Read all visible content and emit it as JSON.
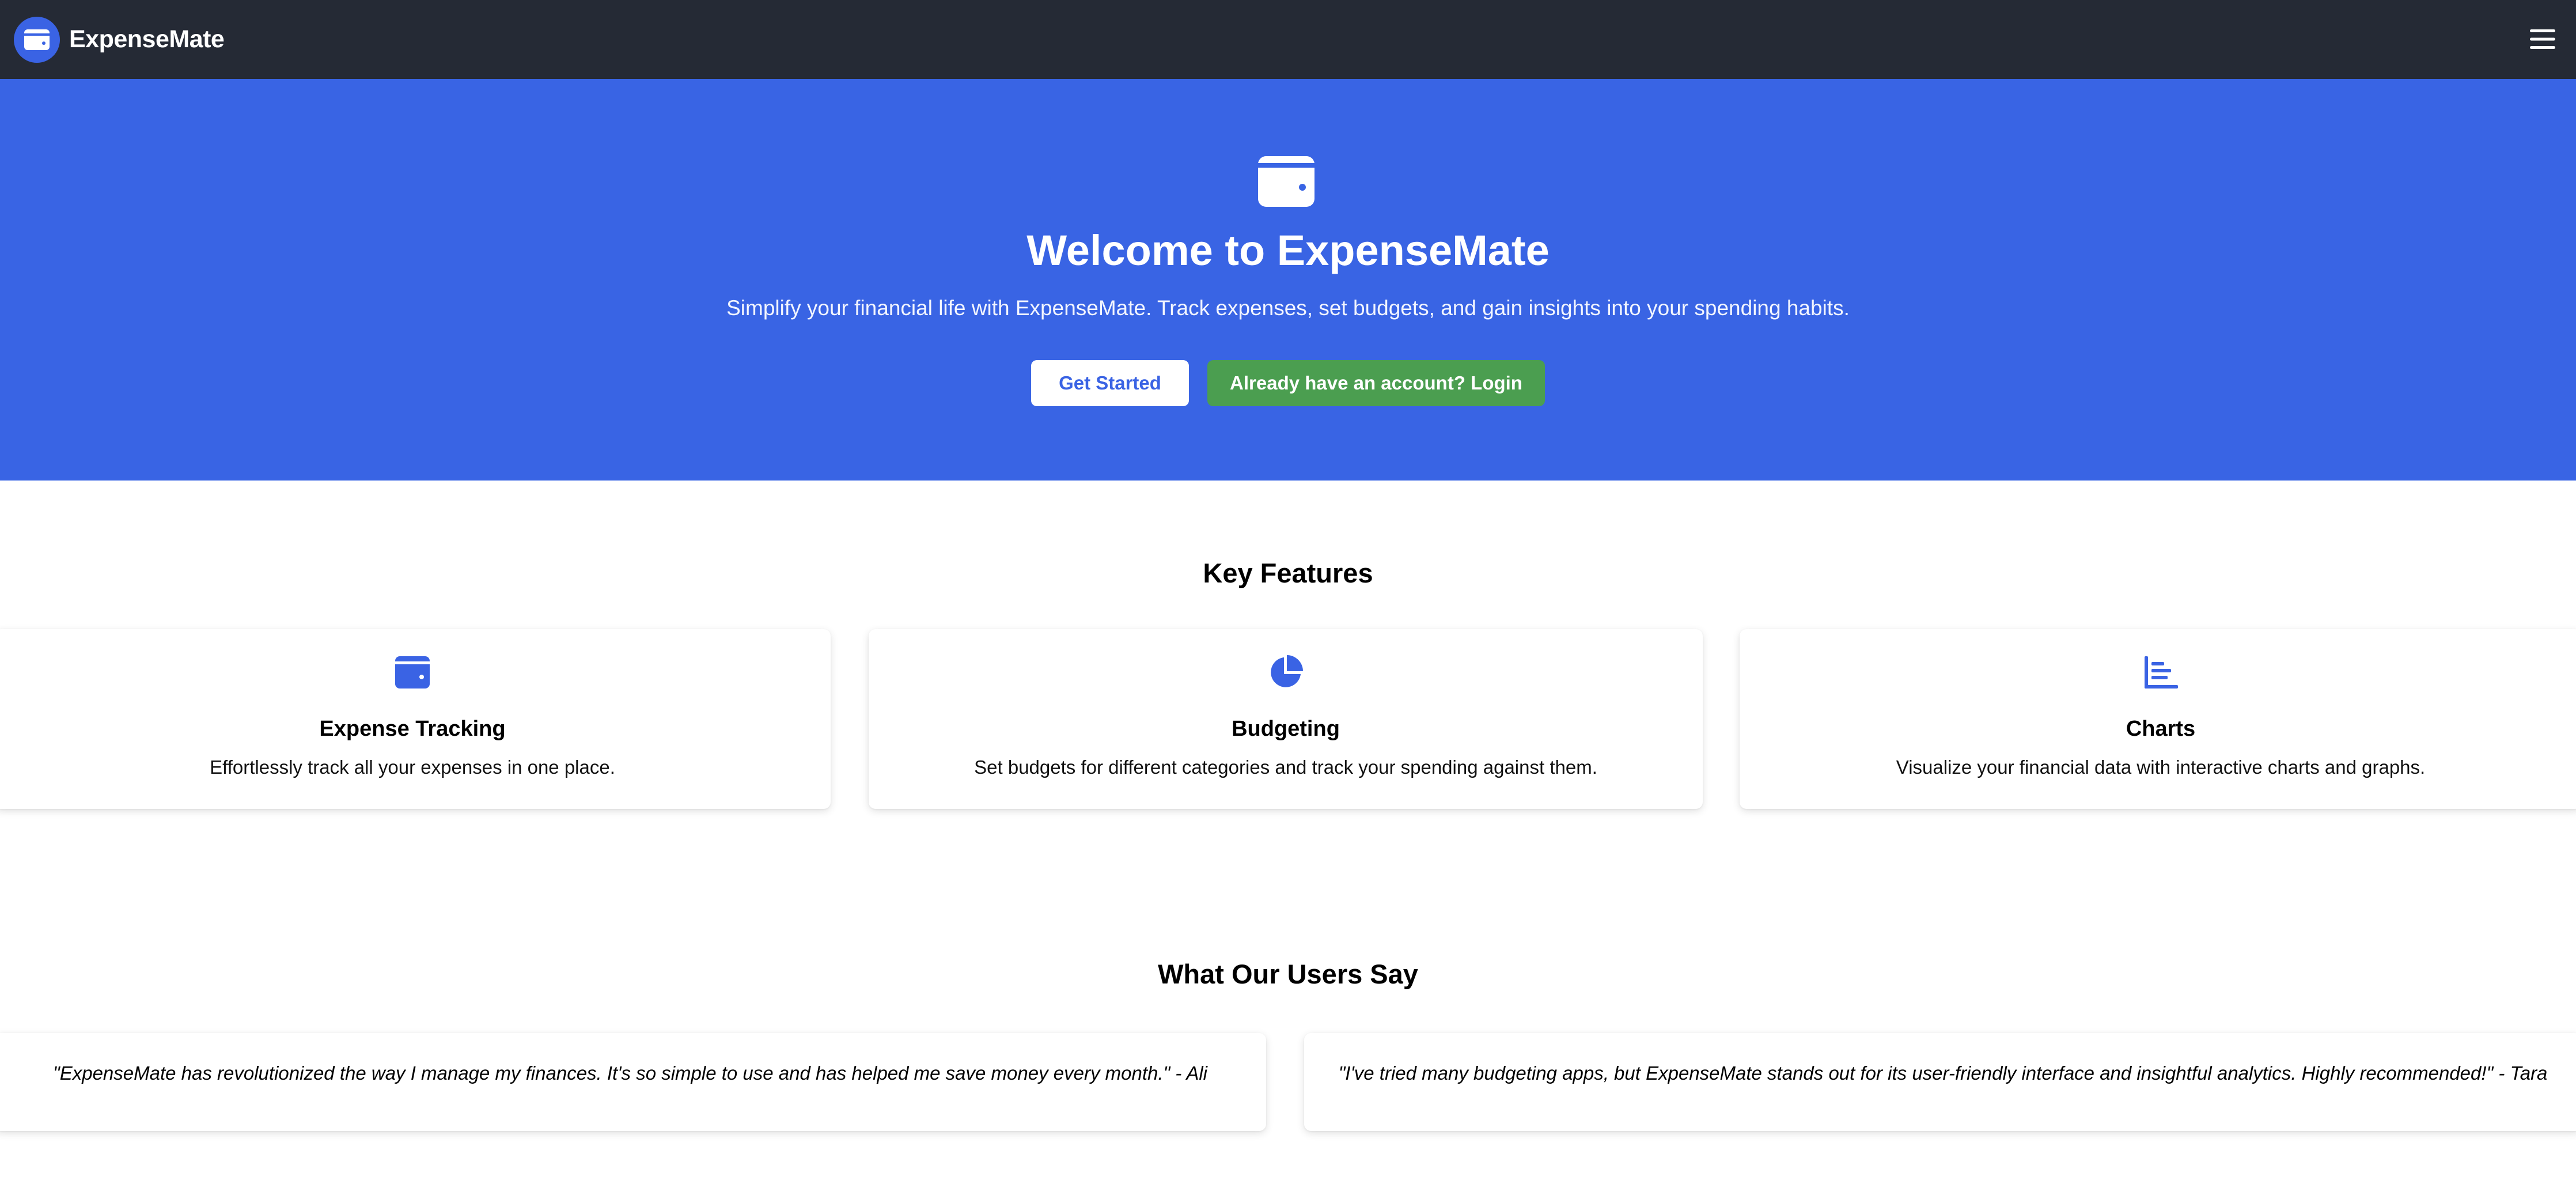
{
  "navbar": {
    "brand_name": "ExpenseMate",
    "logo_icon": "wallet-icon",
    "menu_icon": "hamburger-menu-icon"
  },
  "hero": {
    "icon": "wallet-icon",
    "title": "Welcome to ExpenseMate",
    "subtitle": "Simplify your financial life with ExpenseMate. Track expenses, set budgets, and gain insights into your spending habits.",
    "primary_button": "Get Started",
    "secondary_button": "Already have an account? Login"
  },
  "features": {
    "title": "Key Features",
    "items": [
      {
        "icon": "wallet-icon",
        "title": "Expense Tracking",
        "description": "Effortlessly track all your expenses in one place."
      },
      {
        "icon": "pie-chart-icon",
        "title": "Budgeting",
        "description": "Set budgets for different categories and track your spending against them."
      },
      {
        "icon": "bar-chart-icon",
        "title": "Charts",
        "description": "Visualize your financial data with interactive charts and graphs."
      }
    ]
  },
  "testimonials": {
    "title": "What Our Users Say",
    "items": [
      {
        "quote": "\"ExpenseMate has revolutionized the way I manage my finances. It's so simple to use and has helped me save money every month.\" - Ali"
      },
      {
        "quote": "\"I've tried many budgeting apps, but ExpenseMate stands out for its user-friendly interface and insightful analytics. Highly recommended!\" - Tara"
      }
    ]
  },
  "colors": {
    "navbar_bg": "#252a35",
    "hero_bg": "#3964e4",
    "accent_blue": "#3a63e4",
    "login_green": "#4b9e50"
  }
}
